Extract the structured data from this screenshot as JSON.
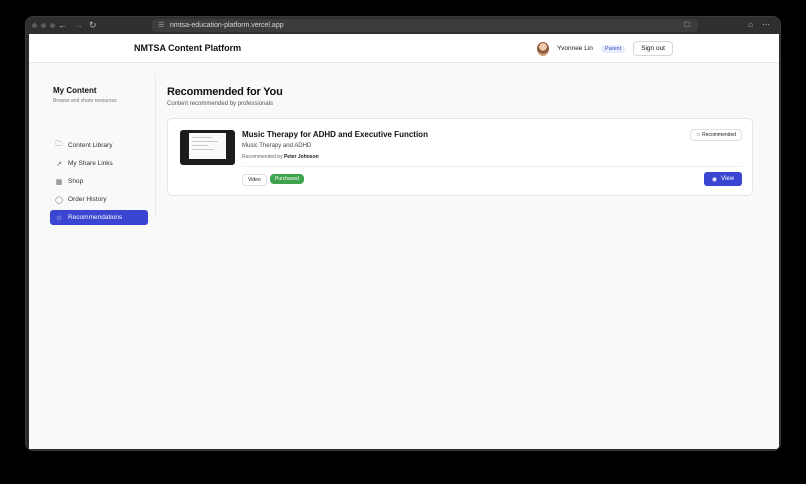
{
  "browser": {
    "url": "nmtsa-education-platform.vercel.app"
  },
  "header": {
    "brand": "NMTSA Content Platform",
    "user_name": "Yvonnee Lin",
    "role_badge": "Parent",
    "signout_label": "Sign out"
  },
  "sidebar": {
    "title": "My Content",
    "subtitle": "Browse and share resources",
    "items": [
      {
        "label": "Content Library",
        "icon": "folder-icon"
      },
      {
        "label": "My Share Links",
        "icon": "external-link-icon"
      },
      {
        "label": "Shop",
        "icon": "calendar-icon"
      },
      {
        "label": "Order History",
        "icon": "package-icon"
      },
      {
        "label": "Recommendations",
        "icon": "star-icon"
      }
    ],
    "active": "Recommendations"
  },
  "main": {
    "title": "Recommended for You",
    "subtitle": "Content recommended by professionals",
    "card": {
      "title": "Music Therapy for ADHD and Executive Function",
      "subtitle": "Music Therapy and ADHD",
      "by_prefix": "Recommended by",
      "by_name": "Peter Johnson",
      "badge": "Recommended",
      "tag_type": "Video",
      "tag_status": "Purchased",
      "view_label": "View"
    }
  },
  "colors": {
    "accent": "#3a45d1",
    "purchased": "#3fa34d"
  }
}
